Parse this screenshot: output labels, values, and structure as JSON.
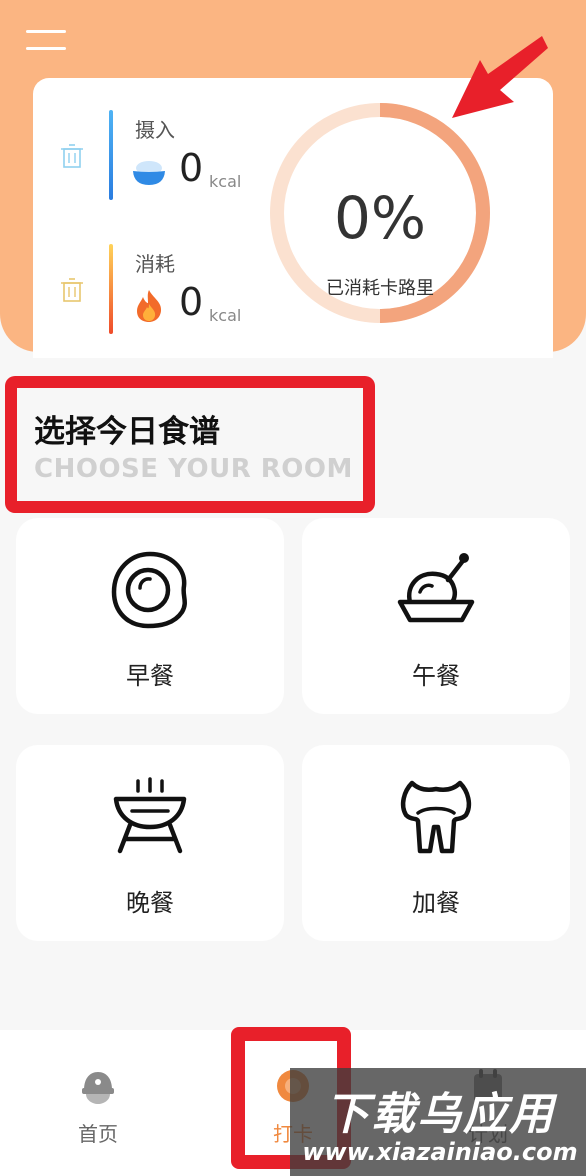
{
  "summary": {
    "intake": {
      "label": "摄入",
      "value": "0",
      "unit": "kcal"
    },
    "burned": {
      "label": "消耗",
      "value": "0",
      "unit": "kcal"
    },
    "progress": {
      "percent_text": "0%",
      "caption": "已消耗卡路里",
      "fraction": 0
    }
  },
  "section": {
    "title": "选择今日食谱",
    "subtitle": "CHOOSE YOUR ROOM"
  },
  "meals": [
    {
      "label": "早餐",
      "icon": "fried-egg-icon"
    },
    {
      "label": "午餐",
      "icon": "roast-chicken-icon"
    },
    {
      "label": "晚餐",
      "icon": "grill-icon"
    },
    {
      "label": "加餐",
      "icon": "snack-icon"
    }
  ],
  "nav": {
    "home": {
      "label": "首页",
      "icon": "home-icon"
    },
    "checkin": {
      "label": "打卡",
      "icon": "checkin-icon"
    },
    "plan": {
      "label": "计划",
      "icon": "plan-icon"
    }
  },
  "watermark": {
    "title": "下载乌应用",
    "url": "www.xiazainiao.com"
  },
  "colors": {
    "header": "#fbb582",
    "accent": "#f0893f",
    "highlight": "#e8202a",
    "ring_track": "#fbe1d0",
    "ring_fill": "#f3a47d"
  }
}
